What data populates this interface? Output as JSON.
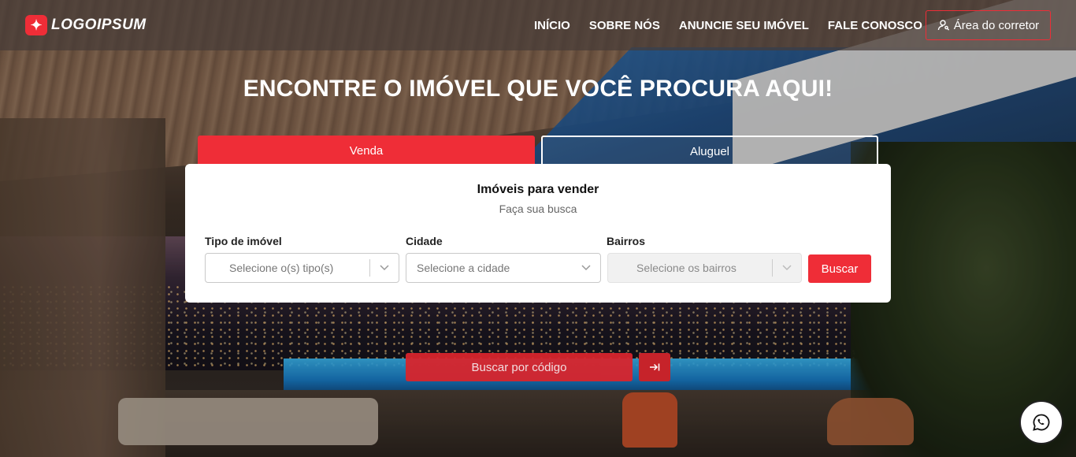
{
  "brand": {
    "logo_text": "LOGOIPSUM",
    "logo_icon": "star-badge-icon",
    "accent": "#ef2d37"
  },
  "nav": {
    "items": [
      {
        "label": "INÍCIO"
      },
      {
        "label": "SOBRE NÓS"
      },
      {
        "label": "ANUNCIE SEU IMÓVEL"
      },
      {
        "label": "FALE CONOSCO"
      }
    ],
    "broker_area": {
      "label": "Área do corretor",
      "icon": "user-key-icon"
    }
  },
  "hero": {
    "headline": "ENCONTRE O IMÓVEL QUE VOCÊ PROCURA AQUI!"
  },
  "tabs": {
    "sale": "Venda",
    "rent": "Aluguel",
    "active": "sale"
  },
  "search": {
    "title": "Imóveis para vender",
    "subtitle": "Faça sua busca",
    "property_type": {
      "label": "Tipo de imóvel",
      "placeholder": "Selecione o(s) tipo(s)"
    },
    "city": {
      "label": "Cidade",
      "placeholder": "Selecione a cidade"
    },
    "neighborhoods": {
      "label": "Bairros",
      "placeholder": "Selecione os bairros",
      "disabled": true
    },
    "submit_label": "Buscar"
  },
  "code_search": {
    "label": "Buscar por código",
    "go_icon": "arrow-to-right-icon"
  },
  "whatsapp": {
    "icon": "whatsapp-icon"
  }
}
